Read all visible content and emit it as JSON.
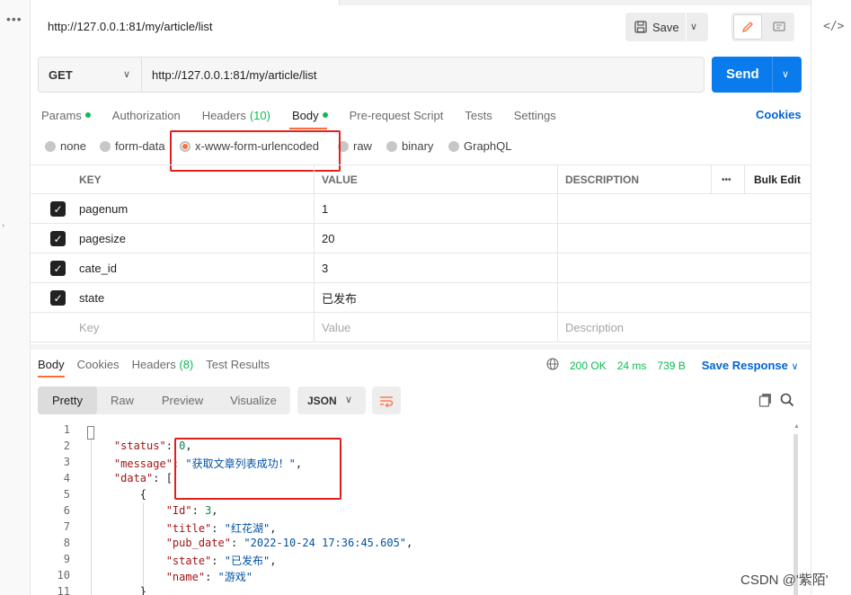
{
  "request": {
    "title": "http://127.0.0.1:81/my/article/list",
    "save_label": "Save",
    "method": "GET",
    "url": "http://127.0.0.1:81/my/article/list",
    "send_label": "Send",
    "tabs": [
      {
        "label": "Params",
        "dot": true
      },
      {
        "label": "Authorization"
      },
      {
        "label": "Headers",
        "count": "(10)"
      },
      {
        "label": "Body",
        "dot": true
      },
      {
        "label": "Pre-request Script"
      },
      {
        "label": "Tests"
      },
      {
        "label": "Settings"
      }
    ],
    "cookies_label": "Cookies",
    "body_types": [
      "none",
      "form-data",
      "x-www-form-urlencoded",
      "raw",
      "binary",
      "GraphQL"
    ],
    "selected_body_type": "x-www-form-urlencoded"
  },
  "params_table": {
    "headers": {
      "key": "KEY",
      "value": "VALUE",
      "description": "DESCRIPTION",
      "more": "•••",
      "bulk_edit": "Bulk Edit"
    },
    "rows": [
      {
        "key": "pagenum",
        "value": "1",
        "checked": true
      },
      {
        "key": "pagesize",
        "value": "20",
        "checked": true
      },
      {
        "key": "cate_id",
        "value": "3",
        "checked": true
      },
      {
        "key": "state",
        "value": "已发布",
        "checked": true
      }
    ],
    "placeholder": {
      "key": "Key",
      "value": "Value",
      "description": "Description"
    }
  },
  "response": {
    "tabs": [
      {
        "label": "Body"
      },
      {
        "label": "Cookies"
      },
      {
        "label": "Headers",
        "count": "(8)"
      },
      {
        "label": "Test Results"
      }
    ],
    "status": "200 OK",
    "time": "24 ms",
    "size": "739 B",
    "save_response_label": "Save Response",
    "view_modes": [
      "Pretty",
      "Raw",
      "Preview",
      "Visualize"
    ],
    "format": "JSON",
    "code_lines": [
      {
        "num": "1",
        "text": "{"
      },
      {
        "num": "2",
        "indent": "    ",
        "key": "\"status\"",
        "sep": ": ",
        "value": "0",
        "vtype": "n",
        "tail": ","
      },
      {
        "num": "3",
        "indent": "    ",
        "key": "\"message\"",
        "sep": ": ",
        "value": "\"获取文章列表成功！\"",
        "vtype": "s",
        "tail": ","
      },
      {
        "num": "4",
        "indent": "    ",
        "key": "\"data\"",
        "sep": ": ",
        "tail": "["
      },
      {
        "num": "5",
        "indent": "        ",
        "tail": "{"
      },
      {
        "num": "6",
        "indent": "            ",
        "key": "\"Id\"",
        "sep": ": ",
        "value": "3",
        "vtype": "n",
        "tail": ","
      },
      {
        "num": "7",
        "indent": "            ",
        "key": "\"title\"",
        "sep": ": ",
        "value": "\"红花湖\"",
        "vtype": "s",
        "tail": ","
      },
      {
        "num": "8",
        "indent": "            ",
        "key": "\"pub_date\"",
        "sep": ": ",
        "value": "\"2022-10-24 17:36:45.605\"",
        "vtype": "s",
        "tail": ","
      },
      {
        "num": "9",
        "indent": "            ",
        "key": "\"state\"",
        "sep": ": ",
        "value": "\"已发布\"",
        "vtype": "s",
        "tail": ","
      },
      {
        "num": "10",
        "indent": "            ",
        "key": "\"name\"",
        "sep": ": ",
        "value": "\"游戏\"",
        "vtype": "s"
      },
      {
        "num": "11",
        "indent": "        ",
        "tail": "}"
      }
    ]
  },
  "watermark": "CSDN @'紫陌'",
  "colors": {
    "accent": "#ff6c37",
    "send": "#097bed",
    "success": "#0cbb52",
    "link": "#0265d2",
    "highlight": "#e0201c"
  }
}
